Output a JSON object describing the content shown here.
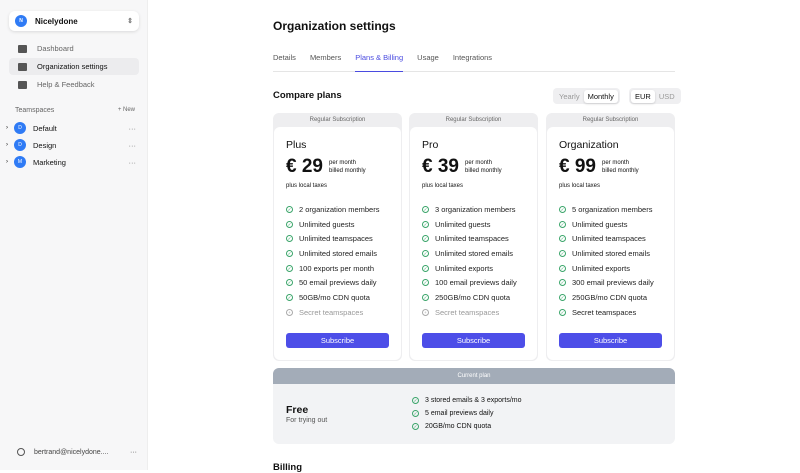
{
  "sidebar": {
    "org": {
      "initial": "N",
      "name": "Nicelydone"
    },
    "nav": [
      {
        "label": "Dashboard"
      },
      {
        "label": "Organization settings"
      },
      {
        "label": "Help & Feedback"
      }
    ],
    "teamspaces_label": "Teamspaces",
    "new_label": "+ New",
    "teamspaces": [
      {
        "initial": "D",
        "name": "Default"
      },
      {
        "initial": "D",
        "name": "Design"
      },
      {
        "initial": "M",
        "name": "Marketing"
      }
    ],
    "user": "bertrand@nicelydone...."
  },
  "main": {
    "title": "Organization settings",
    "tabs": [
      "Details",
      "Members",
      "Plans & Billing",
      "Usage",
      "Integrations"
    ],
    "compare_title": "Compare plans",
    "period": [
      "Yearly",
      "Monthly"
    ],
    "currency": [
      "EUR",
      "USD"
    ],
    "plans": [
      {
        "tag": "Regular Subscription",
        "name": "Plus",
        "price": "€ 29",
        "per": "per month",
        "billed": "billed monthly",
        "tax": "plus local taxes",
        "features": [
          {
            "t": "2 organization members",
            "on": true
          },
          {
            "t": "Unlimited guests",
            "on": true
          },
          {
            "t": "Unlimited teamspaces",
            "on": true
          },
          {
            "t": "Unlimited stored emails",
            "on": true
          },
          {
            "t": "100 exports per month",
            "on": true
          },
          {
            "t": "50 email previews daily",
            "on": true
          },
          {
            "t": "50GB/mo CDN quota",
            "on": true
          },
          {
            "t": "Secret teamspaces",
            "on": false
          }
        ],
        "button": "Subscribe"
      },
      {
        "tag": "Regular Subscription",
        "name": "Pro",
        "price": "€ 39",
        "per": "per month",
        "billed": "billed monthly",
        "tax": "plus local taxes",
        "features": [
          {
            "t": "3 organization members",
            "on": true
          },
          {
            "t": "Unlimited guests",
            "on": true
          },
          {
            "t": "Unlimited teamspaces",
            "on": true
          },
          {
            "t": "Unlimited stored emails",
            "on": true
          },
          {
            "t": "Unlimited exports",
            "on": true
          },
          {
            "t": "100 email previews daily",
            "on": true
          },
          {
            "t": "250GB/mo CDN quota",
            "on": true
          },
          {
            "t": "Secret teamspaces",
            "on": false
          }
        ],
        "button": "Subscribe"
      },
      {
        "tag": "Regular Subscription",
        "name": "Organization",
        "price": "€ 99",
        "per": "per month",
        "billed": "billed monthly",
        "tax": "plus local taxes",
        "features": [
          {
            "t": "5 organization members",
            "on": true
          },
          {
            "t": "Unlimited guests",
            "on": true
          },
          {
            "t": "Unlimited teamspaces",
            "on": true
          },
          {
            "t": "Unlimited stored emails",
            "on": true
          },
          {
            "t": "Unlimited exports",
            "on": true
          },
          {
            "t": "300 email previews daily",
            "on": true
          },
          {
            "t": "250GB/mo CDN quota",
            "on": true
          },
          {
            "t": "Secret teamspaces",
            "on": true
          }
        ],
        "button": "Subscribe"
      }
    ],
    "current": {
      "label": "Current plan",
      "name": "Free",
      "desc": "For trying out",
      "features": [
        "3 stored emails & 3 exports/mo",
        "5 email previews daily",
        "20GB/mo CDN quota"
      ]
    },
    "billing_title": "Billing"
  }
}
